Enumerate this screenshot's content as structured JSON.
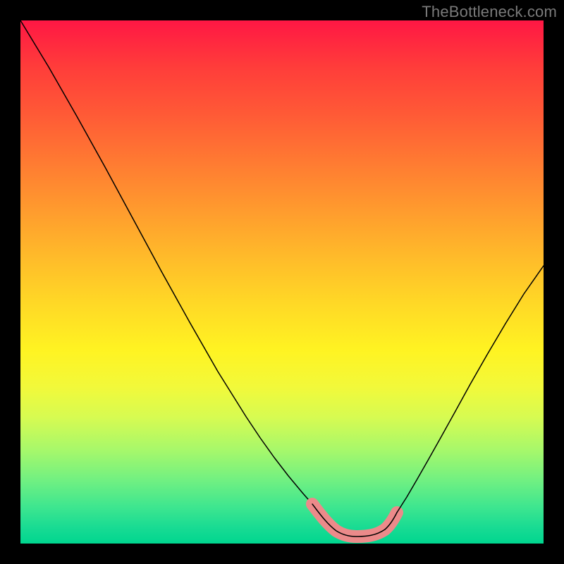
{
  "watermark": "TheBottleneck.com",
  "colors": {
    "frame": "#000000",
    "curve": "#000000",
    "highlight": "#ec8a8a",
    "gradient_top": "#ff1744",
    "gradient_mid": "#fff322",
    "gradient_bottom": "#00d68f"
  },
  "chart_data": {
    "type": "line",
    "title": "",
    "xlabel": "",
    "ylabel": "",
    "x": [
      0.0,
      0.05,
      0.1,
      0.15,
      0.2,
      0.25,
      0.3,
      0.35,
      0.4,
      0.45,
      0.5,
      0.55,
      0.6,
      0.63,
      0.66,
      0.7,
      0.73,
      0.76,
      0.8,
      0.85,
      0.9,
      0.95,
      1.0
    ],
    "values": [
      1.0,
      0.9,
      0.8,
      0.7,
      0.6,
      0.5,
      0.4,
      0.3,
      0.21,
      0.13,
      0.07,
      0.03,
      0.01,
      0.01,
      0.02,
      0.04,
      0.07,
      0.11,
      0.16,
      0.24,
      0.33,
      0.43,
      0.53
    ],
    "xlim": [
      0,
      1
    ],
    "ylim": [
      0,
      1
    ],
    "annotations": [],
    "legend": [],
    "highlight_x_range": [
      0.52,
      0.7
    ],
    "notes": "Axes and ticks are not labeled in the image; x and y are normalized 0–1. Curve shows a deep V-shaped function with its minimum near x≈0.62, y≈0. The pink thick segment marks the low-bottleneck region around the minimum."
  }
}
